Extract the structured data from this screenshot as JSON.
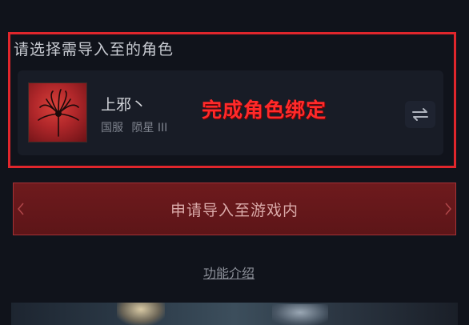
{
  "section": {
    "title": "请选择需导入至的角色"
  },
  "role": {
    "name": "上邪丶",
    "server": "国服",
    "rank": "陨星 III"
  },
  "annotation": "完成角色绑定",
  "actions": {
    "apply_label": "申请导入至游戏内",
    "intro_label": "功能介绍"
  },
  "colors": {
    "highlight": "#e0262c",
    "apply_button": "#6e1a1d",
    "background": "#10131b"
  },
  "icons": {
    "avatar": "red-spider-lily-avatar",
    "switch": "swap-arrows-icon"
  }
}
